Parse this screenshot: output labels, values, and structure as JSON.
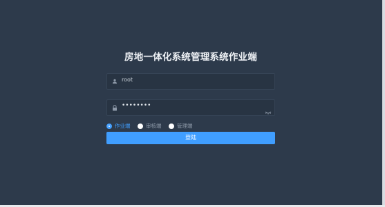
{
  "login": {
    "title": "房地一体化系统管理系统作业端",
    "username": {
      "value": "root",
      "icon": "user-icon"
    },
    "password": {
      "value": "••••••••",
      "icon": "lock-icon",
      "toggle_icon": "eye-icon"
    },
    "roles": [
      {
        "label": "作业端",
        "checked": true
      },
      {
        "label": "审核端",
        "checked": false
      },
      {
        "label": "管理端",
        "checked": false
      }
    ],
    "submit_label": "登陆"
  },
  "colors": {
    "background": "#2d3a4b",
    "accent": "#409eff",
    "input_bg": "#283443"
  }
}
